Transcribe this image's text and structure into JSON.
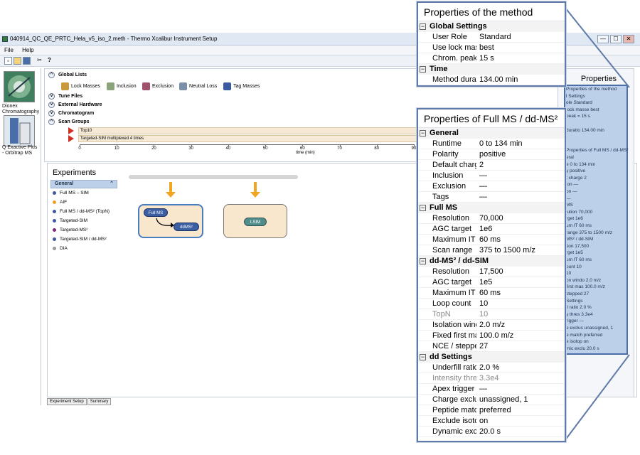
{
  "window": {
    "title": "040914_QC_QE_PRTC_Hela_v5_iso_2.meth - Thermo Xcalibur Instrument Setup",
    "controls": [
      "—",
      "☐",
      "✕"
    ]
  },
  "menu": {
    "items": [
      {
        "label": "File"
      },
      {
        "label": "Help"
      }
    ]
  },
  "toolbar": {
    "icons": [
      "new-icon",
      "open-icon",
      "save-icon",
      "cut-icon",
      "help-icon"
    ]
  },
  "instruments": [
    {
      "label": "Dionex Chromatography"
    },
    {
      "label": "Q Exactive Plus - Orbitrap MS"
    }
  ],
  "sections": {
    "global_lists": {
      "label": "Global Lists",
      "items": [
        {
          "label": "Lock Masses",
          "icon": "lock-masses-icon"
        },
        {
          "label": "Inclusion",
          "icon": "inclusion-icon"
        },
        {
          "label": "Exclusion",
          "icon": "exclusion-icon"
        },
        {
          "label": "Neutral Loss",
          "icon": "neutral-loss-icon"
        },
        {
          "label": "Tag Masses",
          "icon": "tag-masses-icon"
        }
      ]
    },
    "tune_files": {
      "label": "Tune Files"
    },
    "external_hardware": {
      "label": "External Hardware"
    },
    "chromatogram": {
      "label": "Chromatogram"
    },
    "scan_groups": {
      "label": "Scan Groups",
      "rows": [
        {
          "label": "Top10"
        },
        {
          "label": "Targeted-SIM multiplexed 4 times"
        }
      ]
    }
  },
  "axis": {
    "ticks": [
      "0",
      "10",
      "20",
      "30",
      "40",
      "50",
      "60",
      "70",
      "80",
      "90"
    ],
    "unit_label": "time (min)"
  },
  "experiments": {
    "title": "Experiments",
    "group_label": "General",
    "group_icon": "collapse-icon",
    "items": [
      {
        "label": "Full MS – SIM",
        "color": "#3a5ba0"
      },
      {
        "label": "AIF",
        "color": "#f0a020"
      },
      {
        "label": "Full MS / dd-MS² (TopN)",
        "color": "#3a5ba0"
      },
      {
        "label": "Targeted-SIM",
        "color": "#3a5ba0"
      },
      {
        "label": "Targeted-MS²",
        "color": "#7a2a7a"
      },
      {
        "label": "Targeted-SIM / dd-MS²",
        "color": "#3a5ba0"
      },
      {
        "label": "DIA",
        "color": "#999999"
      }
    ]
  },
  "workflow": {
    "card1": {
      "primary": "Full MS",
      "secondary": "ddMS²"
    },
    "card2": {
      "primary": "t-SIM"
    }
  },
  "tabs": [
    {
      "label": "Experiment Setup"
    },
    {
      "label": "Summary"
    }
  ],
  "right_panel": {
    "title": "Properties",
    "lines": [
      "Properties of the method",
      "l Settings",
      "ole        Standard",
      "lock masse  best",
      "peak = 15 s",
      "",
      "duratio   134.00 min",
      "",
      "",
      "Properties of Full MS / dd-MS²",
      "eral",
      "e        0 to 134 min",
      "y        positive",
      "t charge 2",
      "ion      —",
      "on       —",
      "—",
      "MS",
      "lution   70,000",
      "rget     1e6",
      "um IT    60 ms",
      "range    375 to 1500 m/z",
      "MS² / dd-SIM",
      "tion     17,500",
      "rget     1e5",
      "um IT    60 ms",
      "ount     10",
      "10",
      "on windo 2.0 m/z",
      "first mas 100.0 m/z",
      "stepped  27",
      "Settings",
      "ll ratio  2.0 %",
      "y thres   3.3e4",
      "rigger    —",
      "e exclus  unassigned, 1",
      "e match   preferred",
      "e isotop  on",
      "mic exclu 20.0 s"
    ]
  },
  "popup_method": {
    "title": "Properties of the method",
    "sections": [
      {
        "label": "Global Settings",
        "rows": [
          {
            "k": "User Role",
            "v": "Standard"
          },
          {
            "k": "Use lock masses",
            "v": "best"
          },
          {
            "k": "Chrom. peak width",
            "v": "15 s"
          }
        ]
      },
      {
        "label": "Time",
        "rows": [
          {
            "k": "Method duration",
            "v": "134.00 min"
          }
        ]
      }
    ]
  },
  "popup_fullms": {
    "title": "Properties of Full MS / dd-MS²",
    "sections": [
      {
        "label": "General",
        "rows": [
          {
            "k": "Runtime",
            "v": "0 to 134 min"
          },
          {
            "k": "Polarity",
            "v": "positive"
          },
          {
            "k": "Default charge",
            "v": "2"
          },
          {
            "k": "Inclusion",
            "v": "—"
          },
          {
            "k": "Exclusion",
            "v": "—"
          },
          {
            "k": "Tags",
            "v": "—"
          }
        ]
      },
      {
        "label": "Full MS",
        "rows": [
          {
            "k": "Resolution",
            "v": "70,000"
          },
          {
            "k": "AGC target",
            "v": "1e6"
          },
          {
            "k": "Maximum IT",
            "v": "60 ms"
          },
          {
            "k": "Scan range",
            "v": "375 to 1500 m/z"
          }
        ]
      },
      {
        "label": "dd-MS² / dd-SIM",
        "rows": [
          {
            "k": "Resolution",
            "v": "17,500"
          },
          {
            "k": "AGC target",
            "v": "1e5"
          },
          {
            "k": "Maximum IT",
            "v": "60 ms"
          },
          {
            "k": "Loop count",
            "v": "10"
          },
          {
            "k": "TopN",
            "v": "10",
            "dim": true
          },
          {
            "k": "Isolation window",
            "v": "2.0 m/z"
          },
          {
            "k": "Fixed first mass",
            "v": "100.0 m/z"
          },
          {
            "k": "NCE / stepped NCE",
            "v": "27"
          }
        ]
      },
      {
        "label": "dd Settings",
        "rows": [
          {
            "k": "Underfill ratio",
            "v": "2.0 %"
          },
          {
            "k": "Intensity threshold",
            "v": "3.3e4",
            "dim": true
          },
          {
            "k": "Apex trigger",
            "v": "—"
          },
          {
            "k": "Charge exclusion",
            "v": "unassigned, 1"
          },
          {
            "k": "Peptide match",
            "v": "preferred"
          },
          {
            "k": "Exclude isotopes",
            "v": "on"
          },
          {
            "k": "Dynamic exclusion",
            "v": "20.0 s"
          }
        ]
      }
    ]
  }
}
